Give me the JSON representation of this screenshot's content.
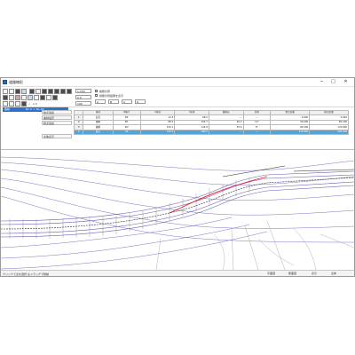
{
  "window": {
    "title": "道路線形"
  },
  "toolbar": {
    "scale_value": "1:250",
    "zoom_value": "1.0",
    "offset_value": "0.0",
    "pitch_value": "100",
    "checkbox_1_label": "縦断計算",
    "checkbox_2_label": "横断計算結果を表示",
    "small_field_1": "A",
    "small_field_2": "B",
    "small_field_3": "C",
    "small_field_4": "D"
  },
  "left_panel": {
    "selected_item_col1": "路線",
    "selected_item_col2": "No.0 〜 No.20"
  },
  "mid_labels": [
    "始点追加",
    "曲線設定",
    "終点追加",
    "",
    "全体表示"
  ],
  "table": {
    "headers": [
      "",
      "種別",
      "IP番号",
      "X座標",
      "Y座標",
      "曲線長",
      "交角",
      "始点距離",
      "終点距離"
    ],
    "rows": [
      [
        "1",
        "起点",
        "BP",
        "12.5",
        "68.0",
        "—",
        "—",
        "0.000",
        "0.000"
      ],
      [
        "2",
        "曲線",
        "IP1",
        "88.3",
        "102.7",
        "40.2",
        "12°",
        "40.000",
        "80.200"
      ],
      [
        "3",
        "曲線",
        "IP2",
        "150.1",
        "145.8",
        "55.6",
        "8°",
        "80.200",
        "135.800"
      ],
      [
        "4",
        "終点",
        "EP",
        "210.4",
        "180.2",
        "—",
        "—",
        "135.800",
        "200.000"
      ]
    ],
    "selected_row": 3
  },
  "status": {
    "message": "クリックで点を選択 左ドラッグで移動",
    "item1": "平面図",
    "item2": "断面図",
    "item3": "表示",
    "item4": "全体"
  },
  "colors": {
    "selection": "#2d73c8",
    "grid_selected_row": "#4fa6d8",
    "alignment_red": "#e02020",
    "contour_lines": "#7a74c4"
  }
}
